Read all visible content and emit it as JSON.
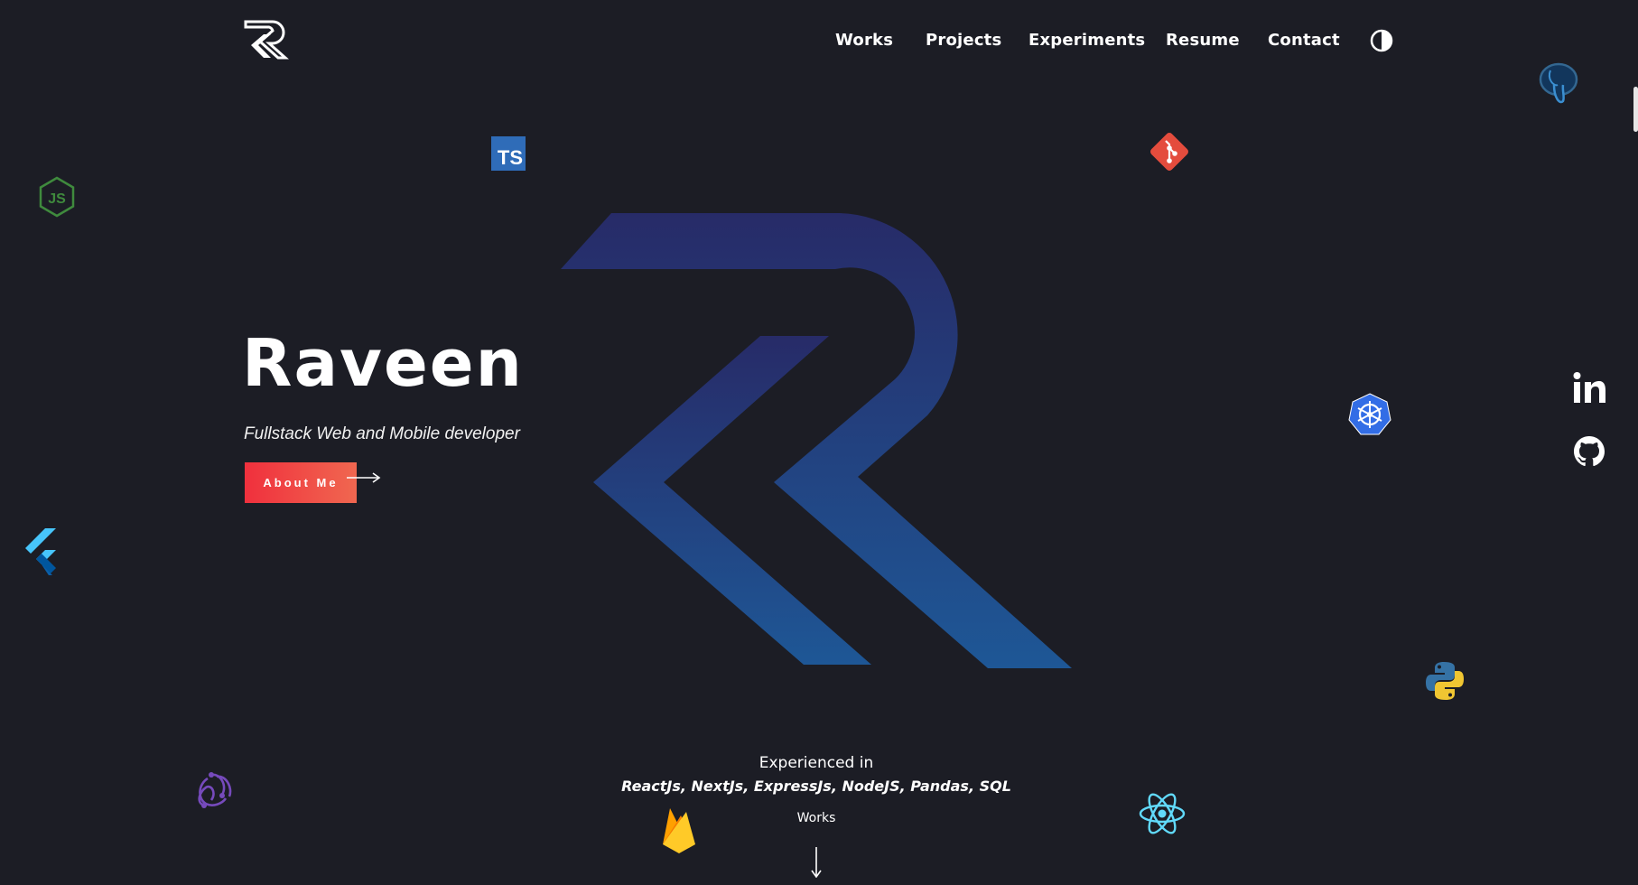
{
  "nav": {
    "links": [
      "Works",
      "Projects",
      "Experiments",
      "Resume",
      "Contact"
    ]
  },
  "hero": {
    "name": "Raveen",
    "subtitle": "Fullstack Web and Mobile developer",
    "cta_label": "About Me"
  },
  "experience": {
    "title": "Experienced in",
    "stack": "ReactJs, NextJs, ExpressJs, NodeJS, Pandas, SQL",
    "works_link": "Works"
  },
  "badges": {
    "typescript": "TS"
  },
  "colors": {
    "background": "#1c1d25",
    "accent_start": "#f0303d",
    "accent_end": "#f06750",
    "logo_top": "#272b68",
    "logo_bottom": "#1e5796"
  },
  "icons": [
    "logo-icon",
    "theme-toggle-icon",
    "typescript-icon",
    "git-icon",
    "nodejs-icon",
    "postgresql-icon",
    "kubernetes-icon",
    "flutter-icon",
    "python-icon",
    "redux-icon",
    "firebase-icon",
    "react-icon",
    "linkedin-icon",
    "github-icon",
    "arrow-right-icon",
    "arrow-down-icon"
  ]
}
